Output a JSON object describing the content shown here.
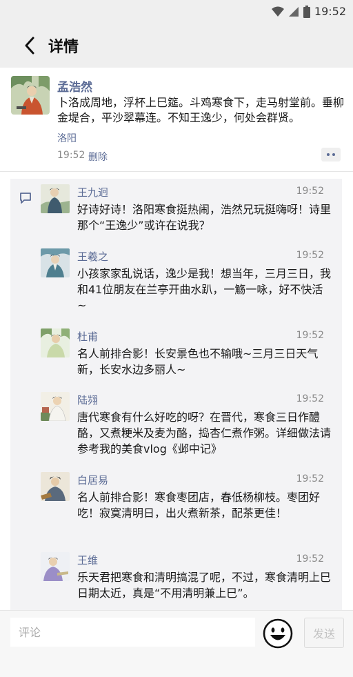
{
  "status": {
    "time": "19:52"
  },
  "header": {
    "title": "详情"
  },
  "post": {
    "author": "孟浩然",
    "text": "卜洛成周地，浮杯上巳筵。斗鸡寒食下，走马射堂前。垂柳金堤合，平沙翠幕连。不知王逸少，何处会群贤。",
    "location": "洛阳",
    "time": "19:52",
    "delete_label": "删除"
  },
  "comments": [
    {
      "name": "王九迥",
      "time": "19:52",
      "text": "好诗好诗！洛阳寒食挺热闹，浩然兄玩挺嗨呀！诗里那个“王逸少”或许在说我？"
    },
    {
      "name": "王羲之",
      "time": "19:52",
      "text": "小孩家家乱说话，逸少是我！想当年，三月三日，我和41位朋友在兰亭开曲水趴，一觞一咏，好不快活~"
    },
    {
      "name": "杜甫",
      "time": "19:52",
      "text": "名人前排合影！长安景色也不输哦~三月三日天气新，长安水边多丽人~"
    },
    {
      "name": "陆翙",
      "time": "19:52",
      "text": "唐代寒食有什么好吃的呀？在晋代，寒食三日作醴酪，又煮粳米及麦为酪，捣杏仁煮作粥。详细做法请参考我的美食vlog《邺中记》"
    },
    {
      "name": "白居易",
      "time": "19:52",
      "text": "名人前排合影！寒食枣团店，春低杨柳枝。枣团好吃！寂寞清明日，出火煮新茶，配茶更佳！"
    },
    {
      "name": "王维",
      "time": "19:52",
      "text": "乐天君把寒食和清明搞混了呢，不过，寒食清明上巳日期太近，真是“不用清明兼上巳”。"
    }
  ],
  "bottom": {
    "placeholder": "评论",
    "send_label": "发送"
  },
  "colors": {
    "link": "#5b6b95",
    "bar": "#efefef",
    "comments_bg": "#f3f3f5"
  }
}
